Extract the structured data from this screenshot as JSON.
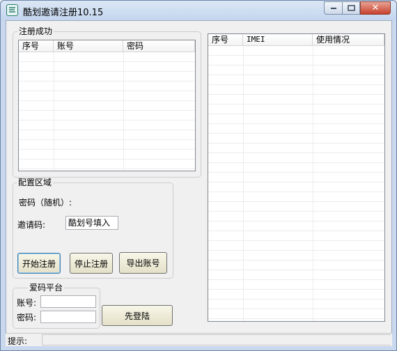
{
  "window": {
    "title": "酷划邀请注册10.15",
    "close_glyph": "✕"
  },
  "success_group": {
    "label": "注册成功",
    "columns": [
      "序号",
      "账号",
      "密码"
    ]
  },
  "imei_list": {
    "columns": [
      "序号",
      "IMEI",
      "使用情况"
    ]
  },
  "config": {
    "label": "配置区域",
    "password_label": "密码（随机）:",
    "invite_label": "邀请码:",
    "invite_value": "酷划号填入",
    "start_button": "开始注册",
    "stop_button": "停止注册",
    "export_button": "导出账号"
  },
  "aima": {
    "label": "爱码平台",
    "account_label": "账号:",
    "account_value": "",
    "password_label": "密码:",
    "password_value": "",
    "login_button": "先登陆"
  },
  "status": {
    "label": "提示:",
    "text": ""
  }
}
